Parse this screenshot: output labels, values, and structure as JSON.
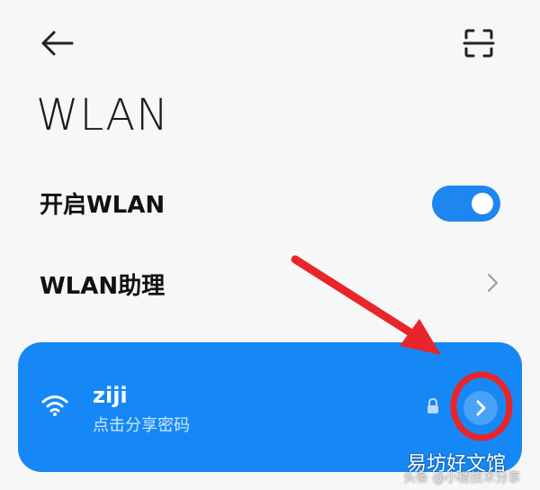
{
  "header": {
    "back_icon": "arrow-left-icon",
    "scan_icon": "scan-qr-icon",
    "title": "WLAN"
  },
  "settings": {
    "wlan_toggle": {
      "label": "开启WLAN",
      "on": true,
      "accent": "#1e86f0"
    },
    "wlan_assistant": {
      "label": "WLAN助理",
      "chevron_icon": "chevron-right-icon"
    }
  },
  "network": {
    "ssid": "ziji",
    "subtitle": "点击分享密码",
    "wifi_icon": "wifi-icon",
    "lock_icon": "lock-icon",
    "detail_icon": "chevron-right-icon",
    "card_color": "#1688f5"
  },
  "annotation": {
    "arrow_color": "#e8252a",
    "circle_target": "network-detail-button"
  },
  "watermark": {
    "main": "易坊好文馆",
    "sub": "头条 @小楼技术分享"
  }
}
